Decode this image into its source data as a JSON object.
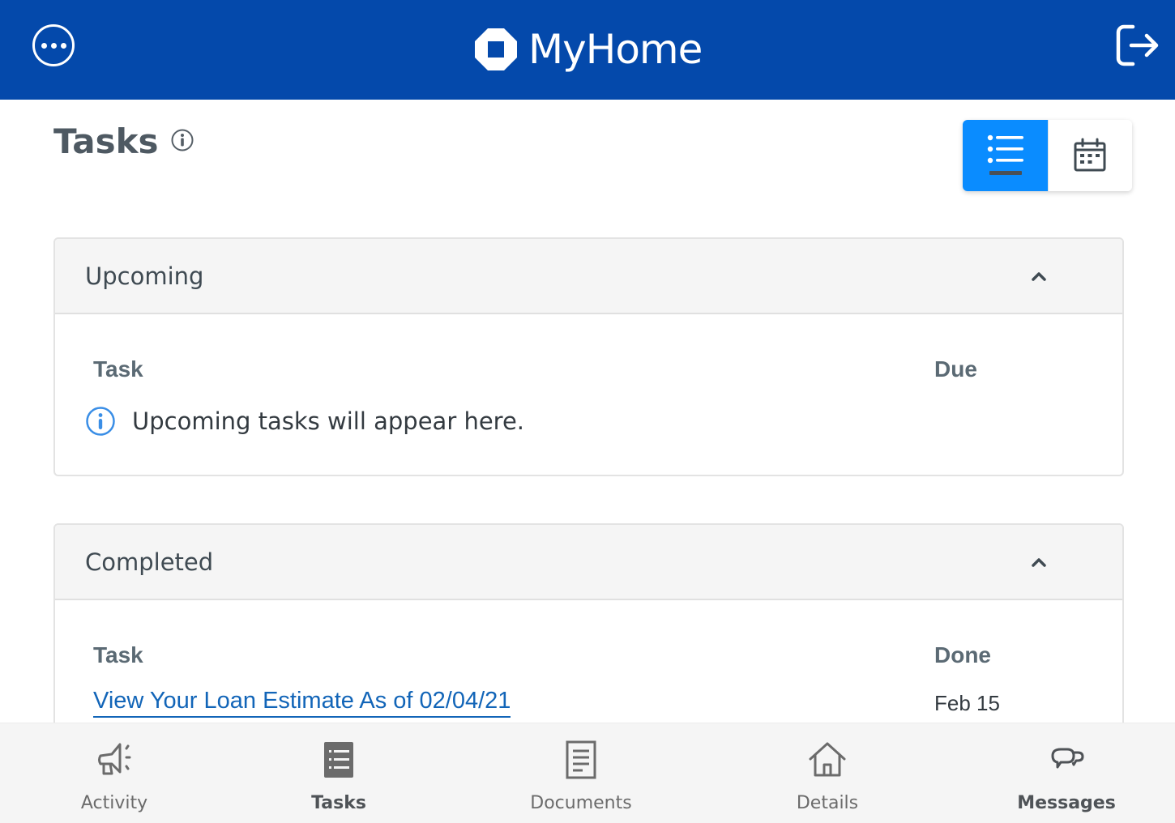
{
  "header": {
    "brand_name": "MyHome",
    "menu_icon": "more-horizontal-circle-icon",
    "logo_icon": "octagon-logo-icon",
    "logout_icon": "sign-out-icon",
    "background_color": "#0449ab"
  },
  "page": {
    "title": "Tasks",
    "title_info_icon": "info-circle-icon"
  },
  "view_toggle": {
    "options": [
      {
        "name": "list-view",
        "icon": "list-icon",
        "active": true
      },
      {
        "name": "calendar-view",
        "icon": "calendar-icon",
        "active": false
      }
    ],
    "active_color": "#0a8cff"
  },
  "sections": {
    "upcoming": {
      "title": "Upcoming",
      "expanded": true,
      "columns": [
        "Task",
        "Due"
      ],
      "empty_message": "Upcoming tasks will appear here.",
      "empty_icon": "info-circle-icon"
    },
    "completed": {
      "title": "Completed",
      "expanded": true,
      "columns": [
        "Task",
        "Done"
      ],
      "rows": [
        {
          "task": "View Your Loan Estimate As of 02/04/21",
          "done": "Feb 15"
        }
      ]
    }
  },
  "bottom_nav": {
    "items": [
      {
        "label": "Activity",
        "icon": "megaphone-icon",
        "active": false
      },
      {
        "label": "Tasks",
        "icon": "task-list-icon",
        "active": true
      },
      {
        "label": "Documents",
        "icon": "document-icon",
        "active": false
      },
      {
        "label": "Details",
        "icon": "home-icon",
        "active": false
      },
      {
        "label": "Messages",
        "icon": "chat-bubbles-icon",
        "active": false
      }
    ]
  },
  "colors": {
    "link": "#1265b8",
    "info_blue": "#3a8ee6",
    "text_dark": "#3f4a52"
  }
}
